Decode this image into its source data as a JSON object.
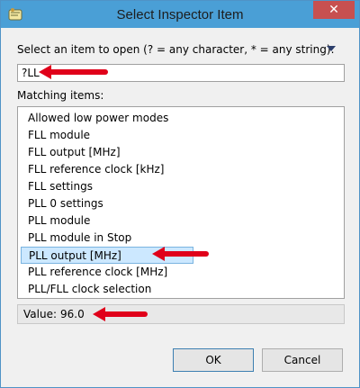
{
  "window": {
    "title": "Select Inspector Item",
    "close_glyph": "✕"
  },
  "dialog": {
    "prompt": "Select an item to open (? = any character, * = any string):",
    "pattern_value": "?LL",
    "matching_label": "Matching items:",
    "items": [
      "Allowed low power modes",
      "FLL module",
      "FLL output [MHz]",
      "FLL reference clock [kHz]",
      "FLL settings",
      "PLL 0 settings",
      "PLL module",
      "PLL module in Stop",
      "PLL output [MHz]",
      "PLL reference clock [MHz]",
      "PLL/FLL clock selection"
    ],
    "selected_index": 8,
    "status": {
      "label": "Value:",
      "value": "96.0"
    }
  },
  "buttons": {
    "ok": "OK",
    "cancel": "Cancel"
  },
  "colors": {
    "titlebar": "#4a9fd6",
    "selection": "#cce8ff",
    "annotation_arrow": "#e0001a"
  },
  "icons": [
    "app-icon",
    "close-icon",
    "menu-arrow-icon",
    "annotation-arrow"
  ]
}
